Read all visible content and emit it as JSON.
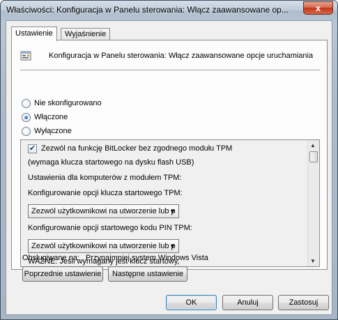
{
  "window": {
    "title": "Właściwości: Konfiguracja w Panelu sterowania: Włącz zaawansowane op...",
    "close_label": "x"
  },
  "tabs": [
    {
      "label": "Ustawienie",
      "active": true
    },
    {
      "label": "Wyjaśnienie",
      "active": false
    }
  ],
  "policy": {
    "icon": "policy-setting-icon",
    "title": "Konfiguracja w Panelu sterowania: Włącz zaawansowane opcje uruchamiania"
  },
  "radios": [
    {
      "label": "Nie skonfigurowano",
      "checked": false
    },
    {
      "label": "Włączone",
      "checked": true
    },
    {
      "label": "Wyłączone",
      "checked": false
    }
  ],
  "options": {
    "checkbox_checked": true,
    "checkbox_label": "Zezwól na funkcję BitLocker bez zgodnego modułu TPM",
    "checkbox_sublabel": "(wymaga klucza startowego na dysku flash USB)",
    "tpm_heading": "Ustawienia dla komputerów z modułem TPM:",
    "startup_key_label": "Konfigurowanie opcji klucza startowego TPM:",
    "startup_key_value": "Zezwól użytkownikowi na utworzenie lub p",
    "pin_label": "Konfigurowanie opcji startowego kodu PIN TPM:",
    "pin_value": "Zezwól użytkownikowi na utworzenie lub p",
    "important_note": "WAŻNE: Jeśli wymagany jest klucz startowy,"
  },
  "supported": {
    "label": "Obsługiwane na:",
    "value": "Przynajmniej system Windows Vista"
  },
  "nav_buttons": {
    "previous": "Poprzednie ustawienie",
    "next": "Następne ustawienie"
  },
  "dialog_buttons": {
    "ok": "OK",
    "cancel": "Anuluj",
    "apply": "Zastosuj"
  }
}
